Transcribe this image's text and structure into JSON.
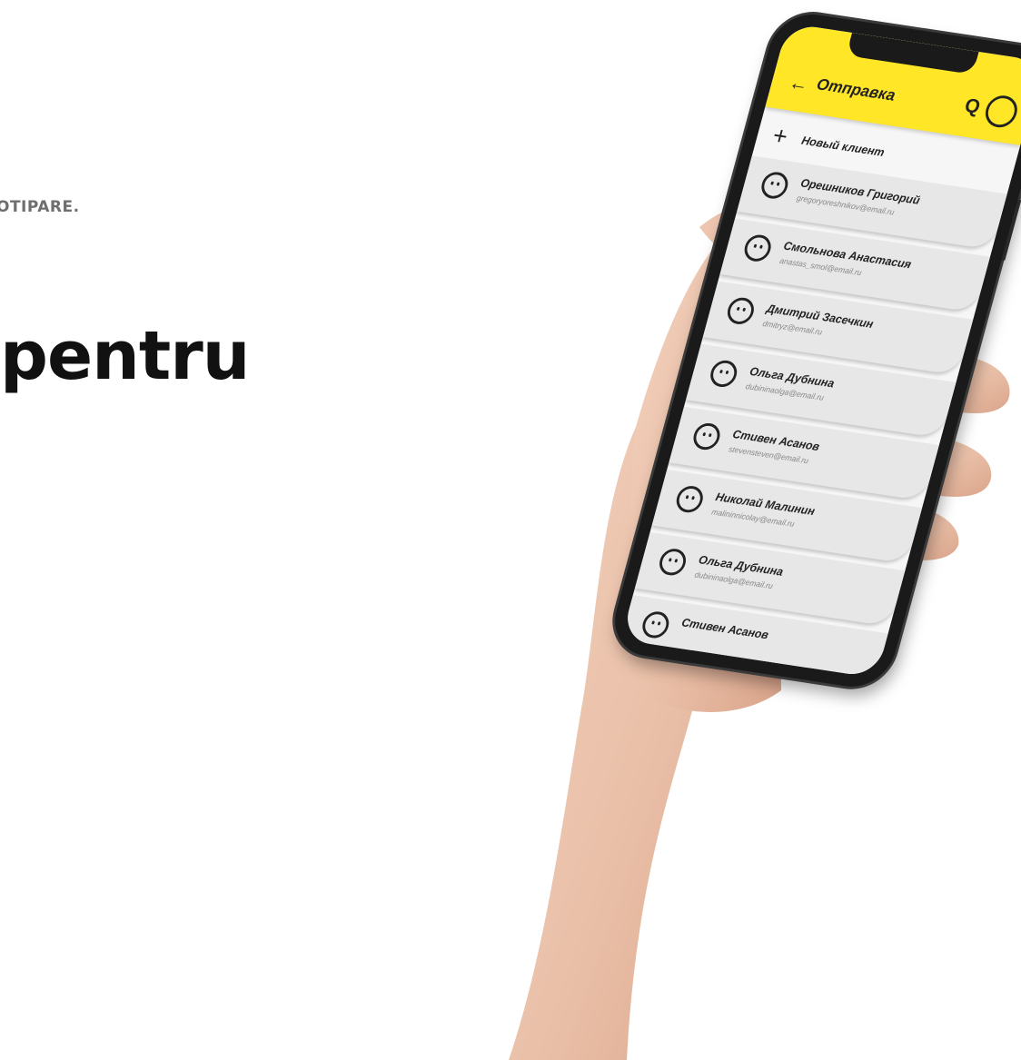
{
  "page": {
    "eyebrow": "OTIPARE.",
    "headline": "pentru"
  },
  "app": {
    "title": "Отправка",
    "back_icon": "arrow-left-icon",
    "search_icon": "search-icon",
    "profile_icon": "smiley-face-icon",
    "accent_color": "#ffe626",
    "new_client_label": "Новый клиент",
    "contacts": [
      {
        "name": "Орешников Григорий",
        "email": "gregoryoreshnikov@email.ru"
      },
      {
        "name": "Смольнова Анастасия",
        "email": "anastas_smol@email.ru"
      },
      {
        "name": "Дмитрий Засечкин",
        "email": "dmitryz@email.ru"
      },
      {
        "name": "Ольга Дубнина",
        "email": "dubininaolga@email.ru"
      },
      {
        "name": "Стивен Асанов",
        "email": "stevensteven@email.ru"
      },
      {
        "name": "Николай Малинин",
        "email": "malininnicolay@email.ru"
      },
      {
        "name": "Ольга Дубнина",
        "email": "dubininaolga@email.ru"
      },
      {
        "name": "Стивен Асанов",
        "email": ""
      }
    ]
  }
}
